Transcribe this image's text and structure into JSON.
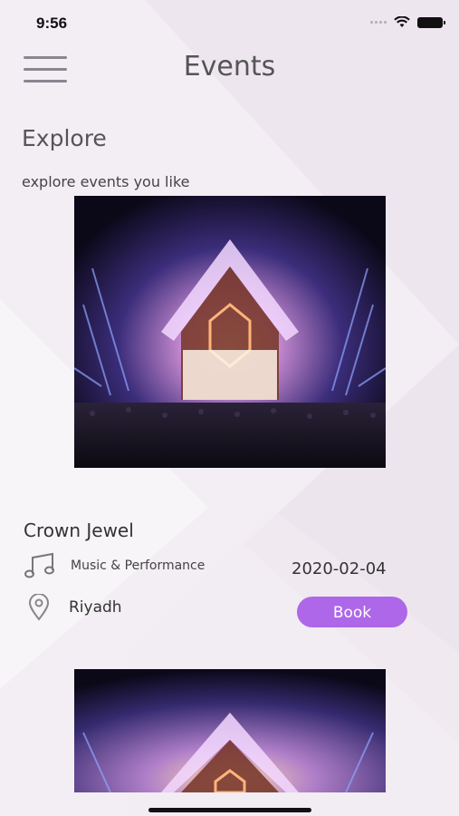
{
  "status_bar": {
    "time": "9:56"
  },
  "header": {
    "title": "Events",
    "menu_icon": "hamburger-menu-icon"
  },
  "explore": {
    "title": "Explore",
    "subtitle": "explore events you like"
  },
  "events": [
    {
      "name": "Crown Jewel",
      "category": "Music & Performance",
      "category_icon": "music-note-icon",
      "date": "2020-02-04",
      "location": "Riyadh",
      "location_icon": "location-pin-icon",
      "book_label": "Book"
    }
  ],
  "colors": {
    "background": "#f3eef4",
    "accent": "#ad67e8",
    "text": "#333333",
    "title": "#555555"
  }
}
